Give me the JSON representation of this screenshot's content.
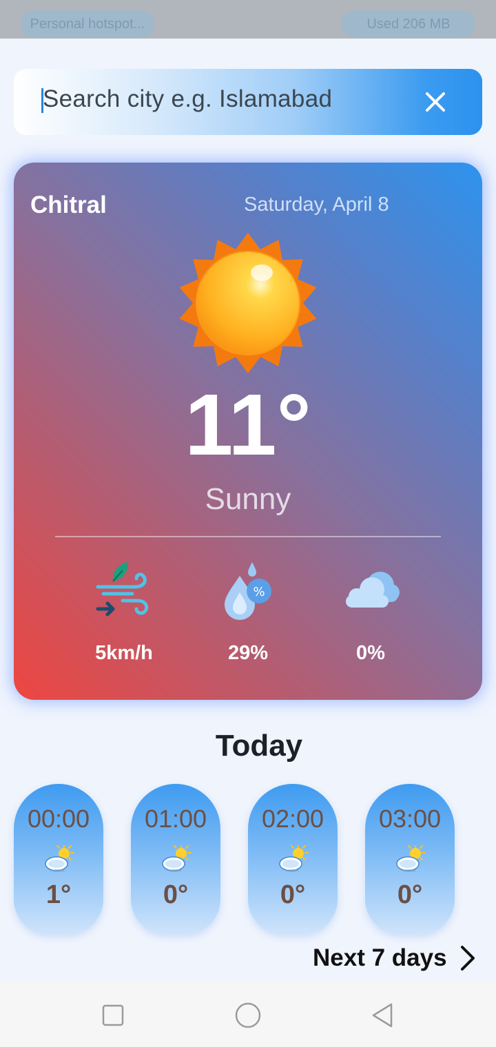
{
  "status_bar": {
    "left_pill": "Personal hotspot...",
    "right_pill": "Used  206 MB"
  },
  "search": {
    "placeholder": "Search city e.g. Islamabad",
    "clear_icon": "close-icon"
  },
  "current": {
    "city": "Chitral",
    "date": "Saturday, April 8",
    "temperature": "11°",
    "condition": "Sunny",
    "icon": "sun-icon",
    "stats": [
      {
        "name": "wind",
        "icon": "wind-icon",
        "value": "5km/h"
      },
      {
        "name": "humidity",
        "icon": "humidity-icon",
        "value": "29%"
      },
      {
        "name": "cloud",
        "icon": "cloud-icon",
        "value": "0%"
      }
    ]
  },
  "today": {
    "title": "Today",
    "hours": [
      {
        "time": "00:00",
        "icon": "partly-cloudy-icon",
        "temp": "1°"
      },
      {
        "time": "01:00",
        "icon": "partly-cloudy-icon",
        "temp": "0°"
      },
      {
        "time": "02:00",
        "icon": "partly-cloudy-icon",
        "temp": "0°"
      },
      {
        "time": "03:00",
        "icon": "partly-cloudy-icon",
        "temp": "0°"
      }
    ]
  },
  "next_days": {
    "label": "Next 7 days"
  },
  "colors": {
    "card_gradient_start": "#ee4640",
    "card_gradient_end": "#2e93ee",
    "hour_card_top": "#3f9bf0",
    "hour_text": "#6b4f45"
  }
}
